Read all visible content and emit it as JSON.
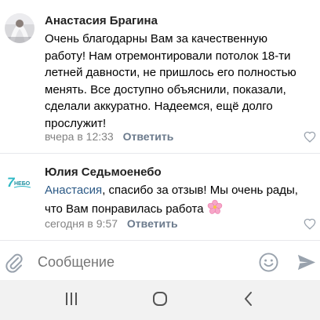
{
  "comments": [
    {
      "author": "Анастасия Брагина",
      "lines": [
        "Очень благодарны Вам за качественную",
        "работу! Нам отремонтировали потолок 18-ти",
        "летней давности, не пришлось его полностью",
        "менять. Все доступно объяснили, показали,",
        "сделали аккуратно. Надеемся, ещё долго",
        "прослужит!"
      ],
      "time": "вчера в 12:33",
      "reply_label": "Ответить"
    },
    {
      "author": "Юлия Седьмоенебо",
      "avatar_text": "НЕБО",
      "avatar_num": "7",
      "mention": "Анастасия",
      "line1_rest": ", спасибо за отзыв! Мы очень рады,",
      "line2": "что Вам понравилась работа",
      "emoji": "🌸",
      "time": "сегодня в 9:57",
      "reply_label": "Ответить"
    }
  ],
  "composer": {
    "placeholder": "Сообщение"
  },
  "icons": {
    "attach": "paperclip-icon",
    "emoji": "smile-icon",
    "send": "send-icon",
    "like": "heart-icon",
    "nav_recent": "recent-apps-icon",
    "nav_home": "home-icon",
    "nav_back": "back-icon"
  },
  "colors": {
    "mention": "#2a5885",
    "meta": "#828282",
    "reply": "#6b7a8c",
    "icon": "#99a2ad",
    "navbar_bg": "#f2f2f2"
  }
}
